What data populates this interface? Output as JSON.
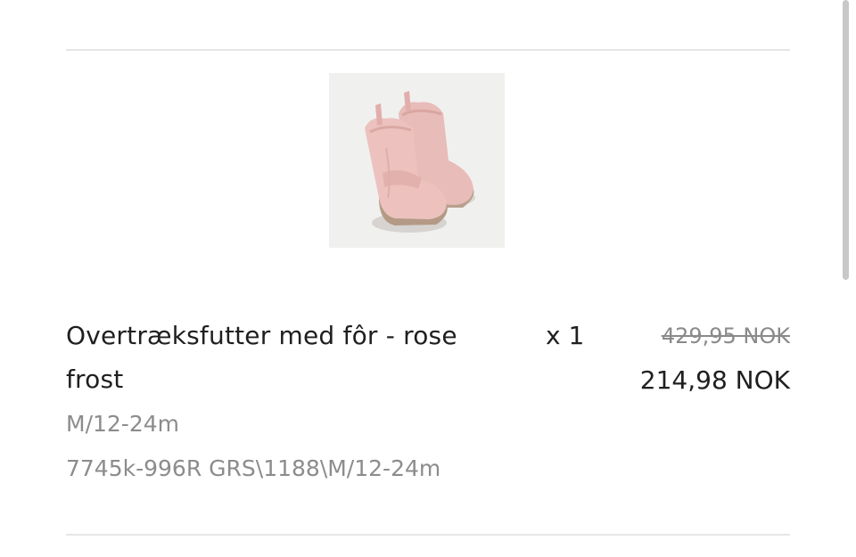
{
  "cart_item": {
    "title": "Overtræksfutter med fôr - rose frost",
    "quantity": "x 1",
    "original_price": "429,95 NOK",
    "sale_price": "214,98 NOK",
    "size": "M/12-24m",
    "sku": "7745k-996R GRS\\1188\\M/12-24m",
    "image_alt": "Overtræksfutter med fôr - rose frost"
  },
  "colors": {
    "text": "#1f1f1f",
    "muted": "#8c8c8c",
    "divider": "#e6e6e6",
    "thumb_bg": "#f0f0ef",
    "product_pink": "#e8b9b6",
    "sole": "#b49a86"
  }
}
